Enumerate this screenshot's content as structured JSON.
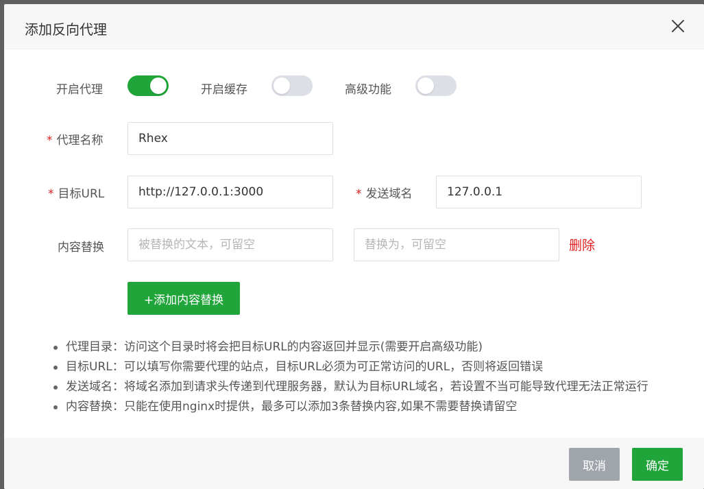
{
  "dialog": {
    "title": "添加反向代理"
  },
  "toggles": [
    {
      "label": "开启代理",
      "on": true
    },
    {
      "label": "开启缓存",
      "on": false
    },
    {
      "label": "高级功能",
      "on": false
    }
  ],
  "form": {
    "required_mark": "*",
    "proxy_name": {
      "label": "代理名称",
      "value": "Rhex"
    },
    "target_url": {
      "label": "目标URL",
      "value": "http://127.0.0.1:3000"
    },
    "send_domain": {
      "label": "发送域名",
      "value": "127.0.0.1"
    },
    "content_replace": {
      "label": "内容替换",
      "from_placeholder": "被替换的文本，可留空",
      "to_placeholder": "替换为，可留空",
      "delete_label": "删除"
    },
    "add_replace_label": "+添加内容替换"
  },
  "tips": [
    "代理目录：访问这个目录时将会把目标URL的内容返回并显示(需要开启高级功能)",
    "目标URL：可以填写你需要代理的站点，目标URL必须为可正常访问的URL，否则将返回错误",
    "发送域名：将域名添加到请求头传递到代理服务器，默认为目标URL域名，若设置不当可能导致代理无法正常运行",
    "内容替换：只能在使用nginx时提供，最多可以添加3条替换内容,如果不需要替换请留空"
  ],
  "footer": {
    "cancel_label": "取消",
    "ok_label": "确定"
  },
  "colors": {
    "accent": "#20a53a",
    "danger": "#e02020",
    "cancel": "#a0a4ab"
  }
}
